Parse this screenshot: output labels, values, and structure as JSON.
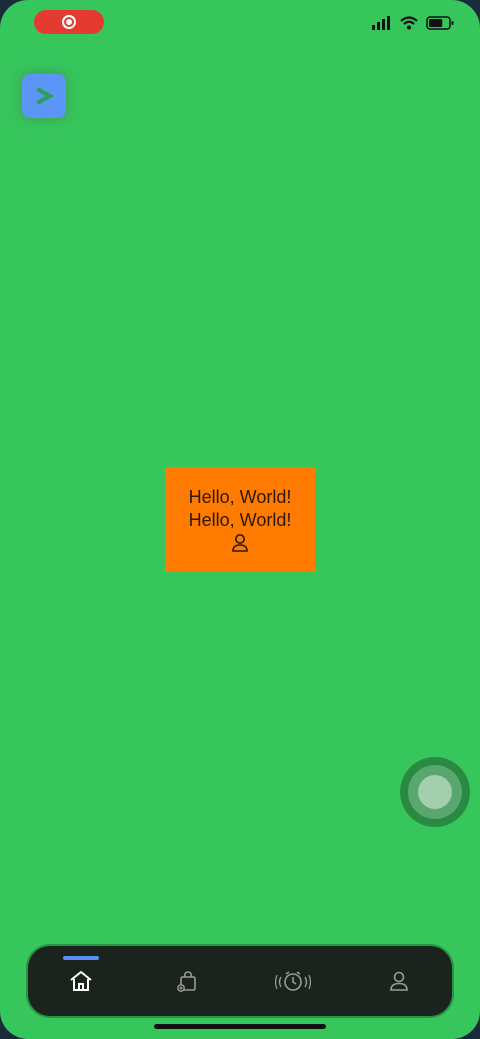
{
  "status_bar": {
    "recording_icon": "screen-record-icon",
    "icons": [
      "cellular-signal-icon",
      "wifi-icon",
      "battery-icon"
    ],
    "battery_level": 0.7
  },
  "floating_button": {
    "icon": "chevron-right-icon",
    "glyph": ">"
  },
  "center_box": {
    "line1": "Hello, World!",
    "line2": "Hello, World!",
    "icon": "person-icon"
  },
  "tab_bar": {
    "tabs": [
      {
        "name": "home",
        "icon": "home-icon",
        "selected": true
      },
      {
        "name": "shopping",
        "icon": "shopping-bag-icon",
        "selected": false
      },
      {
        "name": "alarm",
        "icon": "alarm-clock-icon",
        "selected": false
      },
      {
        "name": "profile",
        "icon": "person-icon",
        "selected": false
      }
    ]
  },
  "colors": {
    "background": "#36c65c",
    "box": "#ff7a00",
    "accent": "#5b8ff5",
    "recording": "#e43a2f",
    "tab_bar": "#1a241d"
  }
}
